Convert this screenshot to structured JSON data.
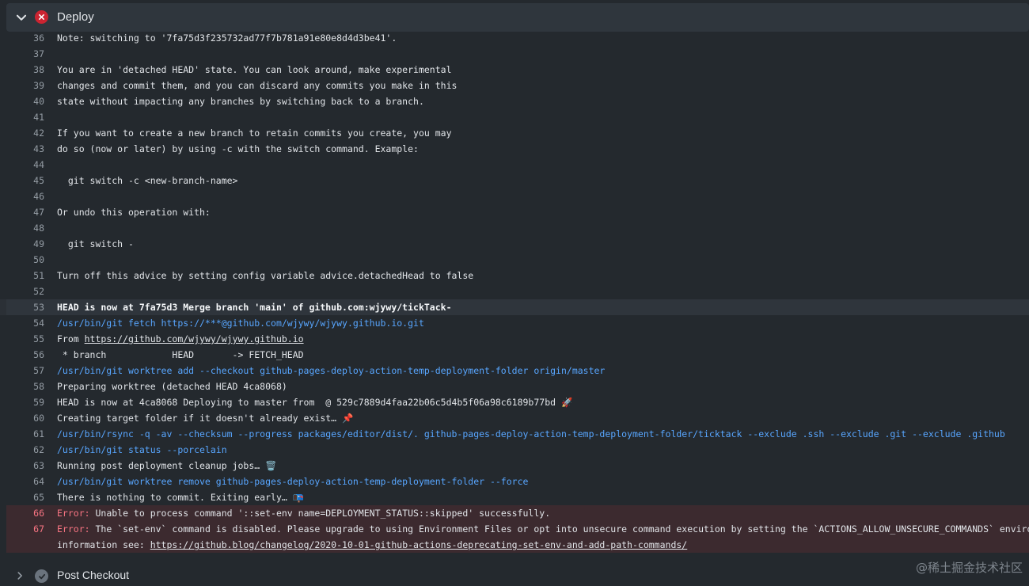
{
  "step": {
    "title": "Deploy",
    "status": "failed"
  },
  "log": [
    {
      "n": "36",
      "text": "Note: switching to '7fa75d3f235732ad77f7b781a91e80e8d4d3be41'.",
      "kind": "plain"
    },
    {
      "n": "37",
      "text": "",
      "kind": "plain"
    },
    {
      "n": "38",
      "text": "You are in 'detached HEAD' state. You can look around, make experimental",
      "kind": "plain"
    },
    {
      "n": "39",
      "text": "changes and commit them, and you can discard any commits you make in this",
      "kind": "plain"
    },
    {
      "n": "40",
      "text": "state without impacting any branches by switching back to a branch.",
      "kind": "plain"
    },
    {
      "n": "41",
      "text": "",
      "kind": "plain"
    },
    {
      "n": "42",
      "text": "If you want to create a new branch to retain commits you create, you may",
      "kind": "plain"
    },
    {
      "n": "43",
      "text": "do so (now or later) by using -c with the switch command. Example:",
      "kind": "plain"
    },
    {
      "n": "44",
      "text": "",
      "kind": "plain"
    },
    {
      "n": "45",
      "text": "  git switch -c <new-branch-name>",
      "kind": "plain"
    },
    {
      "n": "46",
      "text": "",
      "kind": "plain"
    },
    {
      "n": "47",
      "text": "Or undo this operation with:",
      "kind": "plain"
    },
    {
      "n": "48",
      "text": "",
      "kind": "plain"
    },
    {
      "n": "49",
      "text": "  git switch -",
      "kind": "plain"
    },
    {
      "n": "50",
      "text": "",
      "kind": "plain"
    },
    {
      "n": "51",
      "text": "Turn off this advice by setting config variable advice.detachedHead to false",
      "kind": "plain"
    },
    {
      "n": "52",
      "text": "",
      "kind": "plain"
    },
    {
      "n": "53",
      "text": "HEAD is now at 7fa75d3 Merge branch 'main' of github.com:wjywy/tickTack-",
      "kind": "bold"
    },
    {
      "n": "54",
      "text": "/usr/bin/git fetch https://***@github.com/wjywy/wjywy.github.io.git",
      "kind": "cmd"
    },
    {
      "n": "55",
      "prefix": "From ",
      "link": "https://github.com/wjywy/wjywy.github.io",
      "kind": "linkline"
    },
    {
      "n": "56",
      "text": " * branch            HEAD       -> FETCH_HEAD",
      "kind": "plain"
    },
    {
      "n": "57",
      "text": "/usr/bin/git worktree add --checkout github-pages-deploy-action-temp-deployment-folder origin/master",
      "kind": "cmd"
    },
    {
      "n": "58",
      "text": "Preparing worktree (detached HEAD 4ca8068)",
      "kind": "plain"
    },
    {
      "n": "59",
      "text": "HEAD is now at 4ca8068 Deploying to master from  @ 529c7889d4faa22b06c5d4b5f06a98c6189b77bd 🚀",
      "kind": "plain"
    },
    {
      "n": "60",
      "text": "Creating target folder if it doesn't already exist… 📌",
      "kind": "plain"
    },
    {
      "n": "61",
      "text": "/usr/bin/rsync -q -av --checksum --progress packages/editor/dist/. github-pages-deploy-action-temp-deployment-folder/ticktack --exclude .ssh --exclude .git --exclude .github",
      "kind": "cmd"
    },
    {
      "n": "62",
      "text": "/usr/bin/git status --porcelain",
      "kind": "cmd"
    },
    {
      "n": "63",
      "text": "Running post deployment cleanup jobs… 🗑️",
      "kind": "plain"
    },
    {
      "n": "64",
      "text": "/usr/bin/git worktree remove github-pages-deploy-action-temp-deployment-folder --force",
      "kind": "cmd"
    },
    {
      "n": "65",
      "text": "There is nothing to commit. Exiting early… 📭",
      "kind": "plain"
    },
    {
      "n": "66",
      "label": "Error:",
      "text": " Unable to process command '::set-env name=DEPLOYMENT_STATUS::skipped' successfully.",
      "kind": "error"
    },
    {
      "n": "67",
      "label": "Error:",
      "text": " The `set-env` command is disabled. Please upgrade to using Environment Files or opt into unsecure command execution by setting the `ACTIONS_ALLOW_UNSECURE_COMMANDS` environment variable to `true`. For more",
      "kind": "error"
    },
    {
      "n": "",
      "prefix": "information see: ",
      "link": "https://github.blog/changelog/2020-10-01-github-actions-deprecating-set-env-and-add-path-commands/",
      "kind": "errorcont"
    }
  ],
  "next_step": {
    "title": "Post Checkout",
    "status": "completed"
  },
  "watermark": "@稀土掘金技术社区",
  "colors": {
    "background": "#24292e",
    "error": "#cb2431",
    "command": "#58a6ff",
    "error_text": "#f97583"
  }
}
